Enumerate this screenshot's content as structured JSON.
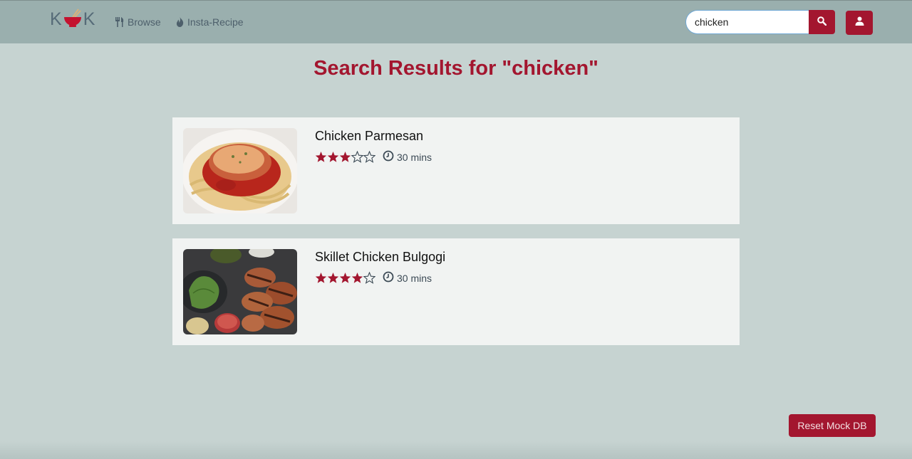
{
  "nav": {
    "logo_left": "K",
    "logo_right": "K",
    "browse_label": "Browse",
    "insta_label": "Insta-Recipe",
    "search_value": "chicken"
  },
  "page": {
    "title": "Search Results for \"chicken\""
  },
  "results": [
    {
      "name": "Chicken Parmesan",
      "rating": 3,
      "max_rating": 5,
      "time": "30 mins"
    },
    {
      "name": "Skillet Chicken Bulgogi",
      "rating": 4,
      "max_rating": 5,
      "time": "30 mins"
    }
  ],
  "footer": {
    "reset_label": "Reset Mock DB"
  },
  "colors": {
    "accent": "#a3162f",
    "navbar": "#9aafae",
    "background": "#c6d3d1",
    "card": "#f1f3f2"
  }
}
